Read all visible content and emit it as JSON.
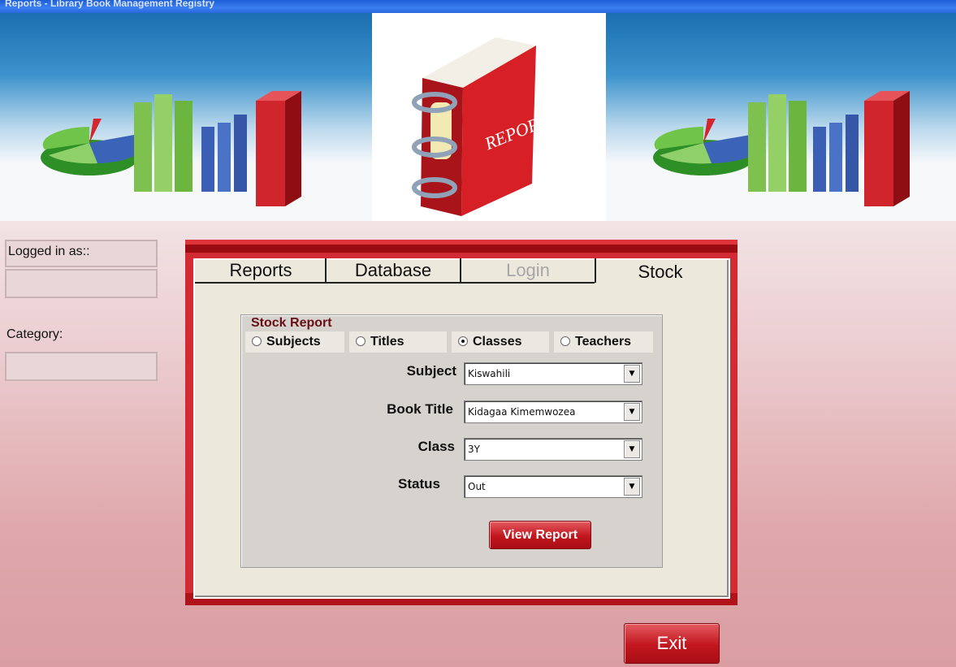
{
  "window": {
    "title": "Reports - Library Book Management Registry"
  },
  "banner": {
    "logo_text": "REPORT"
  },
  "sidebar": {
    "logged_in_label": "Logged in as::",
    "logged_in_value": "",
    "category_label": "Category:",
    "category_value": ""
  },
  "tabs": [
    {
      "label": "Reports",
      "state": "normal"
    },
    {
      "label": "Database",
      "state": "normal"
    },
    {
      "label": "Login",
      "state": "disabled"
    },
    {
      "label": "Stock",
      "state": "active"
    }
  ],
  "stock_report": {
    "legend": "Stock Report",
    "radios": [
      {
        "label": "Subjects",
        "selected": false
      },
      {
        "label": "Titles",
        "selected": false
      },
      {
        "label": "Classes",
        "selected": true
      },
      {
        "label": "Teachers",
        "selected": false
      }
    ],
    "fields": {
      "subject": {
        "label": "Subject",
        "value": "Kiswahili"
      },
      "book_title": {
        "label": "Book Title",
        "value": "Kidagaa Kimemwozea"
      },
      "class": {
        "label": "Class",
        "value": "3Y"
      },
      "status": {
        "label": "Status",
        "value": "Out"
      }
    },
    "view_report_label": "View Report"
  },
  "exit_label": "Exit",
  "colors": {
    "accent": "#d22b33",
    "dark_red": "#9b0b12",
    "panel_bg": "#ede8dc"
  }
}
